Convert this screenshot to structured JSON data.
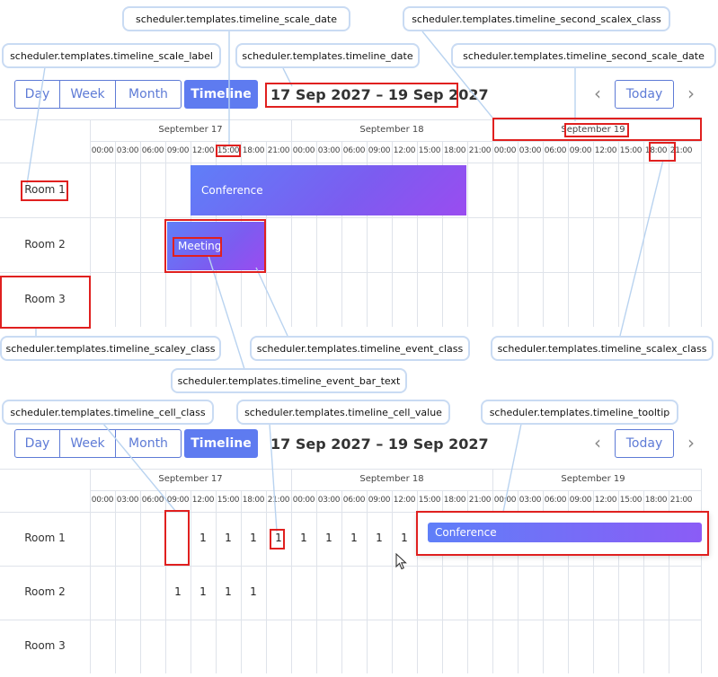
{
  "toolbar": {
    "views": [
      "Day",
      "Week",
      "Month",
      "Timeline"
    ],
    "active_view": "Timeline",
    "date_range": "17 Sep 2027 – 19 Sep 2027",
    "today_label": "Today",
    "prev_icon": "chevron-left-icon",
    "next_icon": "chevron-right-icon"
  },
  "timeline": {
    "days": [
      "September 17",
      "September 18",
      "September 19"
    ],
    "hours": [
      "00:00",
      "03:00",
      "06:00",
      "09:00",
      "12:00",
      "15:00",
      "18:00",
      "21:00"
    ],
    "rooms": [
      "Room 1",
      "Room 2",
      "Room 3"
    ]
  },
  "top_panel": {
    "events": [
      {
        "text": "Conference",
        "room": "Room 1",
        "start": "Sep 17 12:00",
        "end": "Sep 18 21:00"
      },
      {
        "text": "Meeting",
        "room": "Room 2",
        "start": "Sep 17 09:00",
        "end": "Sep 17 18:00"
      }
    ]
  },
  "bottom_panel": {
    "cell_values": [
      {
        "room": "Room 1",
        "columns": [
          4,
          5,
          6,
          7,
          8,
          9,
          10,
          11,
          12
        ],
        "value": "1"
      },
      {
        "room": "Room 2",
        "columns": [
          3,
          4,
          5,
          6
        ],
        "value": "1"
      }
    ],
    "tooltip": {
      "event_text": "Conference"
    }
  },
  "annotations": {
    "timeline_scale_date": "scheduler.templates.timeline_scale_date",
    "timeline_second_scalex_class": "scheduler.templates.timeline_second_scalex_class",
    "timeline_scale_label": "scheduler.templates.timeline_scale_label",
    "timeline_date": "scheduler.templates.timeline_date",
    "timeline_second_scale_date": "scheduler.templates.timeline_second_scale_date",
    "timeline_scaley_class": "scheduler.templates.timeline_scaley_class",
    "timeline_event_class": "scheduler.templates.timeline_event_class",
    "timeline_scalex_class": "scheduler.templates.timeline_scalex_class",
    "timeline_event_bar_text": "scheduler.templates.timeline_event_bar_text",
    "timeline_cell_class": "scheduler.templates.timeline_cell_class",
    "timeline_cell_value": "scheduler.templates.timeline_cell_value",
    "timeline_tooltip": "scheduler.templates.timeline_tooltip"
  },
  "colors": {
    "accent": "#5e7bf0",
    "highlight": "#e0201f",
    "leader": "#b9d3f0",
    "event_gradient": [
      "#5f7ff8",
      "#9a4cf0"
    ]
  }
}
